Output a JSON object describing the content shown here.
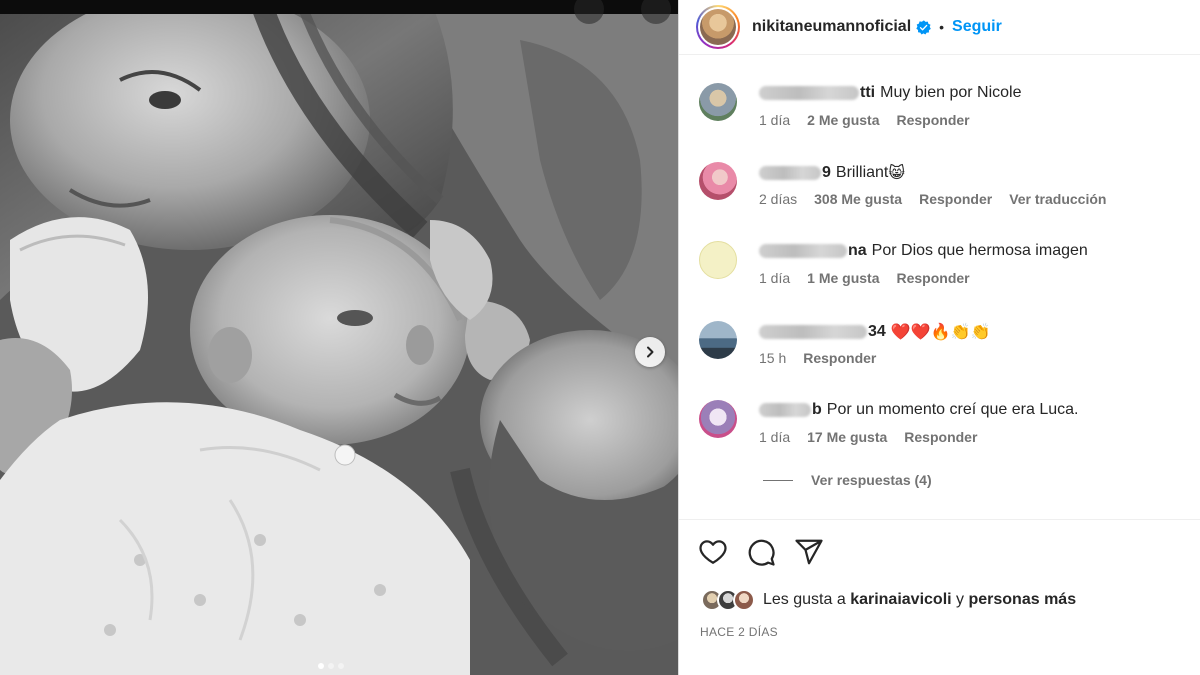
{
  "post": {
    "author": "nikitaneumannoficial",
    "separator": "•",
    "follow_label": "Seguir",
    "verified": true,
    "carousel": {
      "slides": 3,
      "active_index": 0
    }
  },
  "comments": [
    {
      "username_visible_tail": "tti",
      "text": "Muy bien por Nicole",
      "time": "1 día",
      "likes": "2 Me gusta",
      "reply_label": "Responder",
      "translate_label": ""
    },
    {
      "username_visible_tail": "9",
      "text": "Brilliant",
      "emoji": "😸",
      "time": "2 días",
      "likes": "308 Me gusta",
      "reply_label": "Responder",
      "translate_label": "Ver traducción"
    },
    {
      "username_visible_tail": "na",
      "text": "Por Dios que hermosa imagen",
      "time": "1 día",
      "likes": "1 Me gusta",
      "reply_label": "Responder",
      "translate_label": ""
    },
    {
      "username_visible_tail": "34",
      "text": "",
      "emoji": "❤️❤️🔥👏👏",
      "time": "15 h",
      "likes": "",
      "reply_label": "Responder",
      "translate_label": ""
    },
    {
      "username_visible_tail": "b",
      "text": "Por un momento creí que era Luca.",
      "time": "1 día",
      "likes": "17 Me gusta",
      "reply_label": "Responder",
      "translate_label": ""
    }
  ],
  "view_replies_label": "Ver respuestas (4)",
  "likes_summary": {
    "prefix": "Les gusta a",
    "user": "karinaiavicoli",
    "connector": "y",
    "rest": "personas más"
  },
  "posted_ago": "HACE 2 DÍAS",
  "icons": {
    "like": "heart-icon",
    "comment": "comment-icon",
    "share": "send-icon",
    "verified": "verified-badge-icon",
    "next": "chevron-right-icon"
  },
  "colors": {
    "accent": "#0095f6",
    "verified": "#0095f6",
    "text": "#262626",
    "muted": "#737373"
  }
}
